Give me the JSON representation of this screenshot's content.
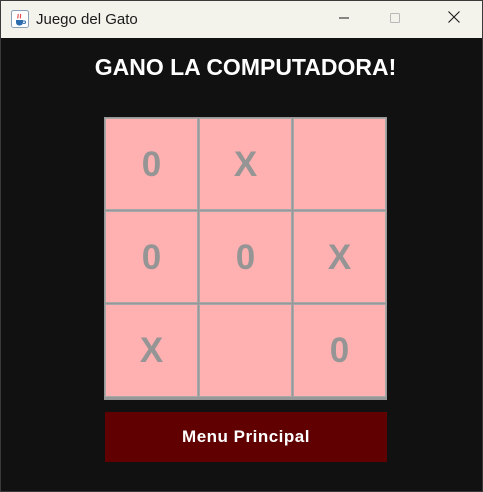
{
  "window": {
    "title": "Juego del Gato",
    "icon": "java-cup-icon",
    "controls": [
      "minimize-icon",
      "maximize-icon",
      "close-icon"
    ]
  },
  "game": {
    "status_text": "GANO LA COMPUTADORA!",
    "board": [
      [
        "0",
        "X",
        ""
      ],
      [
        "0",
        "0",
        "X"
      ],
      [
        "X",
        "",
        "0"
      ]
    ]
  },
  "menu": {
    "main_menu_label": "Menu Principal"
  },
  "colors": {
    "background": "#111111",
    "titlebar": "#f3f3ec",
    "cell": "#ffb0b0",
    "cell_text": "#959595",
    "grid_lines": "#979797",
    "menu_button": "#600000",
    "status_text": "#ffffff"
  }
}
